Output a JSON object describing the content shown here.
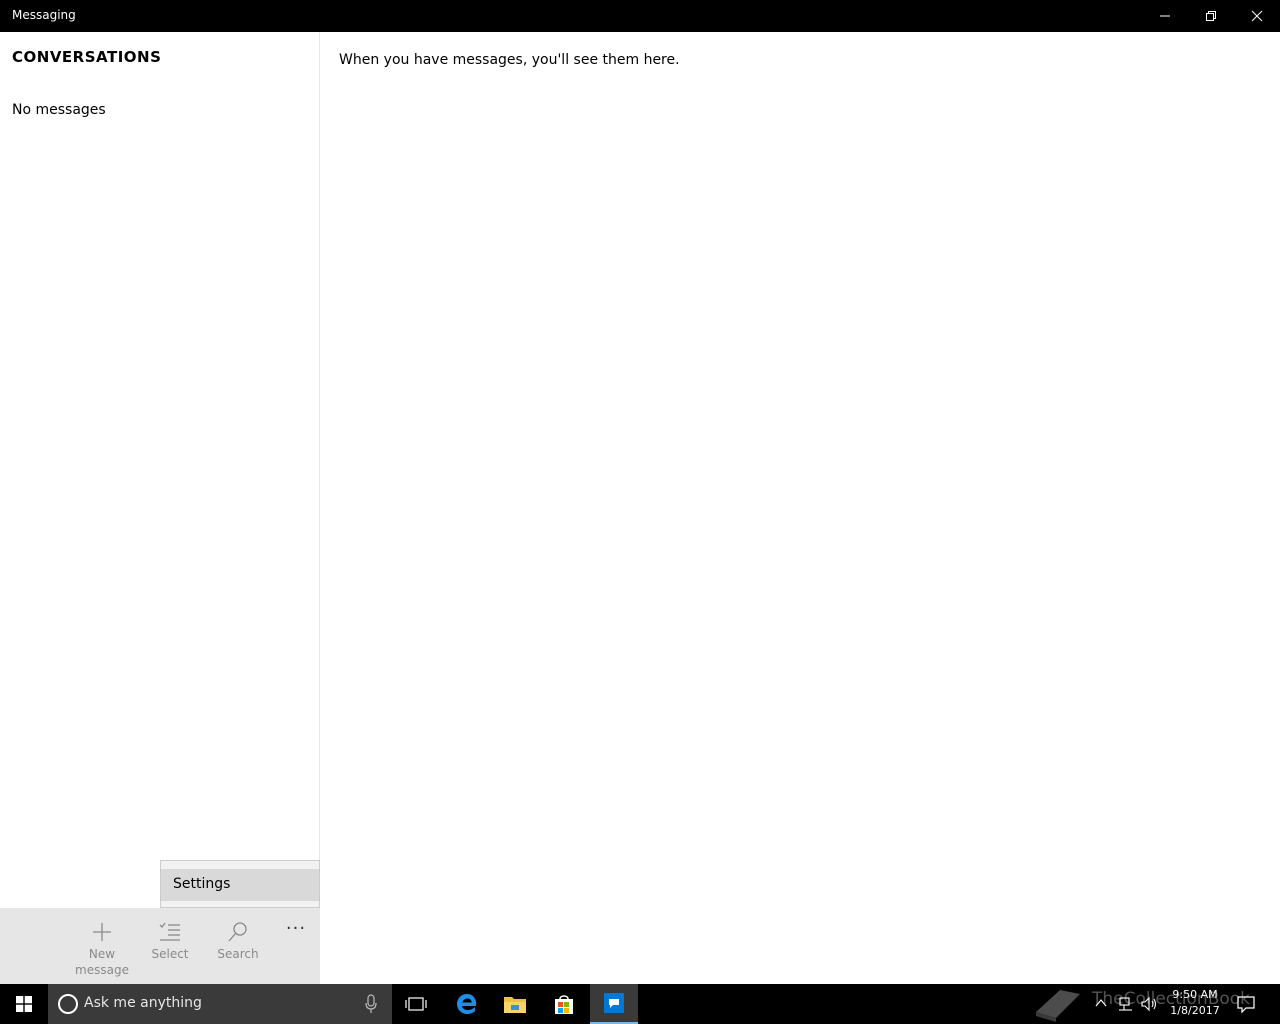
{
  "window": {
    "title": "Messaging",
    "controls": [
      "minimize",
      "maximize",
      "close"
    ]
  },
  "left_pane": {
    "heading": "CONVERSATIONS",
    "empty_text": "No messages"
  },
  "right_pane": {
    "empty_text": "When you have messages, you'll see them here."
  },
  "popup_menu": {
    "items": [
      {
        "label": "Settings"
      }
    ]
  },
  "app_bar": {
    "new_message_label_line1": "New",
    "new_message_label_line2": "message",
    "select_label": "Select",
    "search_label": "Search",
    "more_label": "···"
  },
  "taskbar": {
    "search_placeholder": "Ask me anything",
    "pinned": [
      "task-view-icon",
      "edge-icon",
      "file-explorer-icon",
      "store-icon",
      "messaging-icon"
    ],
    "active_app": "messaging-icon",
    "clock": {
      "time": "9:50 AM",
      "date": "1/8/2017"
    },
    "watermark_text": "TheCollectionBook"
  },
  "colors": {
    "titlebar": "#000000",
    "taskbar": "#000000",
    "appbar": "#e6e6e6",
    "accent": "#0078d7",
    "popup_highlight": "#d9d9d9"
  }
}
